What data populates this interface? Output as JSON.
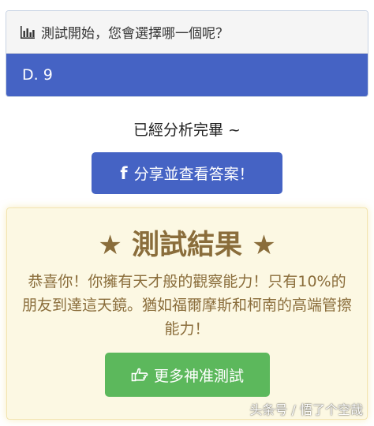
{
  "question": {
    "icon": "bar-chart-icon",
    "title": "測試開始，您會選擇哪一個呢？",
    "selected_answer": "D. 9"
  },
  "analysis_text": "已經分析完畢 ~",
  "share_button": {
    "icon": "facebook-icon",
    "label": "分享並查看答案！"
  },
  "result": {
    "star": "★",
    "title": "測試結果",
    "description": "恭喜你！你擁有天才般的觀察能力！只有10%的朋友到達這天鏡。猶如福爾摩斯和柯南的高端管擦能力！",
    "more_button": {
      "icon": "hand-pointer-icon",
      "label": "更多神准測試"
    }
  },
  "watermark": "头条号 / 悟了个空哉",
  "colors": {
    "primary_blue": "#4563c4",
    "success_green": "#5cb85c",
    "result_bg": "#fcf8e3",
    "result_text": "#8a6d3b"
  }
}
